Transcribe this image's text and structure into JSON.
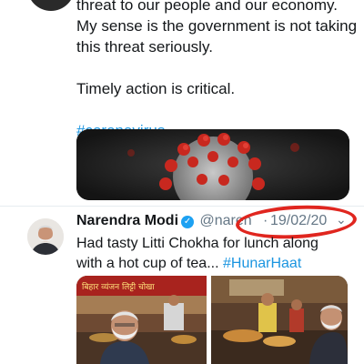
{
  "tweet1": {
    "lines": [
      "threat to our people and our economy.",
      "My sense is the government is not taking",
      "this threat seriously.",
      "Timely action is critical."
    ],
    "hashtag": "#coronavirus"
  },
  "tweet2": {
    "author_name": "Narendra Modi",
    "handle": "@naren",
    "separator": "·",
    "date": "19/02/20",
    "text_line1": "Had tasty Litti Chokha for lunch along",
    "text_line2_plain": "with a hot cup of tea... ",
    "hashtag": "#HunarHaat"
  },
  "media": {
    "stall_sign": "बिहार व्यंजन लिट्टी चोखा"
  },
  "colors": {
    "link": "#1b95e0",
    "verified": "#1da1f2",
    "annotation_circle": "#e0261f",
    "muted": "#657786"
  },
  "icons": {
    "verified": "verified-badge-icon",
    "chevron": "chevron-down-icon"
  }
}
